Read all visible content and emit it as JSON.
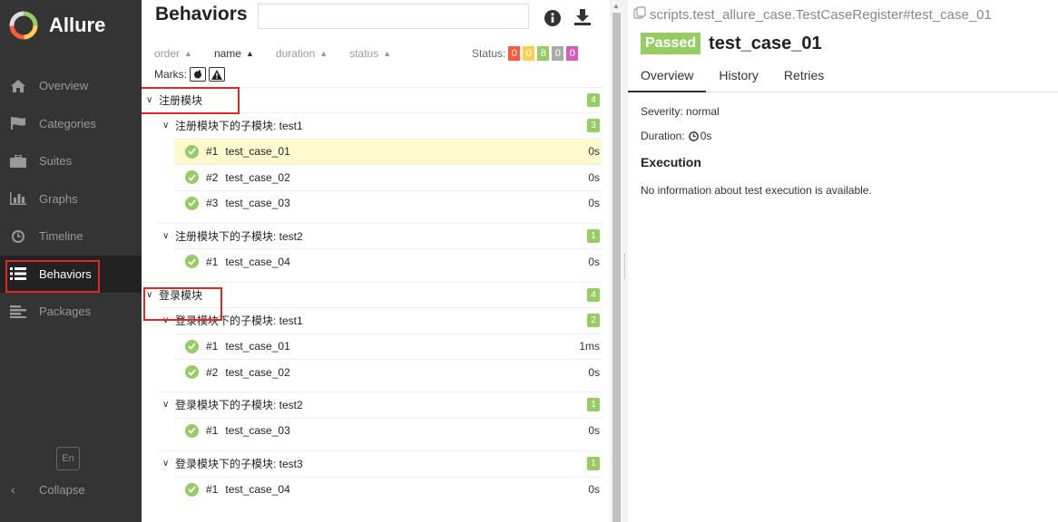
{
  "app": {
    "name": "Allure"
  },
  "colors": {
    "sidebar_bg": "#343434",
    "passed": "#97cc64",
    "failed": "#fd5a3e",
    "broken": "#ffd050",
    "skipped": "#aaaaaa",
    "unknown": "#d35ebe",
    "highlight": "#fffacd",
    "annotation": "#e02828"
  },
  "sidebar": {
    "items": [
      {
        "label": "Overview",
        "icon": "home-icon"
      },
      {
        "label": "Categories",
        "icon": "flag-icon"
      },
      {
        "label": "Suites",
        "icon": "briefcase-icon"
      },
      {
        "label": "Graphs",
        "icon": "bar-chart-icon"
      },
      {
        "label": "Timeline",
        "icon": "clock-icon"
      },
      {
        "label": "Behaviors",
        "icon": "list-icon",
        "active": true
      },
      {
        "label": "Packages",
        "icon": "align-left-icon"
      }
    ],
    "language": "En",
    "collapse_label": "Collapse"
  },
  "tree_pane": {
    "title": "Behaviors",
    "search_value": "",
    "sort": {
      "order": "order",
      "name": "name",
      "duration": "duration",
      "status": "status"
    },
    "status_label": "Status:",
    "status_counts": [
      {
        "status": "failed",
        "count": "0"
      },
      {
        "status": "broken",
        "count": "0"
      },
      {
        "status": "passed",
        "count": "8"
      },
      {
        "status": "skipped",
        "count": "0"
      },
      {
        "status": "unknown",
        "count": "0"
      }
    ],
    "marks_label": "Marks:",
    "groups": [
      {
        "label": "注册模块",
        "count": "4",
        "subgroups": [
          {
            "label": "注册模块下的子模块: test1",
            "count": "3",
            "tests": [
              {
                "num": "#1",
                "name": "test_case_01",
                "duration": "0s",
                "selected": true
              },
              {
                "num": "#2",
                "name": "test_case_02",
                "duration": "0s"
              },
              {
                "num": "#3",
                "name": "test_case_03",
                "duration": "0s"
              }
            ]
          },
          {
            "label": "注册模块下的子模块: test2",
            "count": "1",
            "tests": [
              {
                "num": "#1",
                "name": "test_case_04",
                "duration": "0s"
              }
            ]
          }
        ]
      },
      {
        "label": "登录模块",
        "count": "4",
        "subgroups": [
          {
            "label": "登录模块下的子模块: test1",
            "count": "2",
            "tests": [
              {
                "num": "#1",
                "name": "test_case_01",
                "duration": "1ms"
              },
              {
                "num": "#2",
                "name": "test_case_02",
                "duration": "0s"
              }
            ]
          },
          {
            "label": "登录模块下的子模块: test2",
            "count": "1",
            "tests": [
              {
                "num": "#1",
                "name": "test_case_03",
                "duration": "0s"
              }
            ]
          },
          {
            "label": "登录模块下的子模块: test3",
            "count": "1",
            "tests": [
              {
                "num": "#1",
                "name": "test_case_04",
                "duration": "0s"
              }
            ]
          }
        ]
      }
    ]
  },
  "details": {
    "path": "scripts.test_allure_case.TestCaseRegister#test_case_01",
    "status": "Passed",
    "title": "test_case_01",
    "tabs": [
      "Overview",
      "History",
      "Retries"
    ],
    "severity": "Severity: normal",
    "duration_label": "Duration:",
    "duration_value": "0s",
    "execution_heading": "Execution",
    "execution_text": "No information about test execution is available."
  }
}
